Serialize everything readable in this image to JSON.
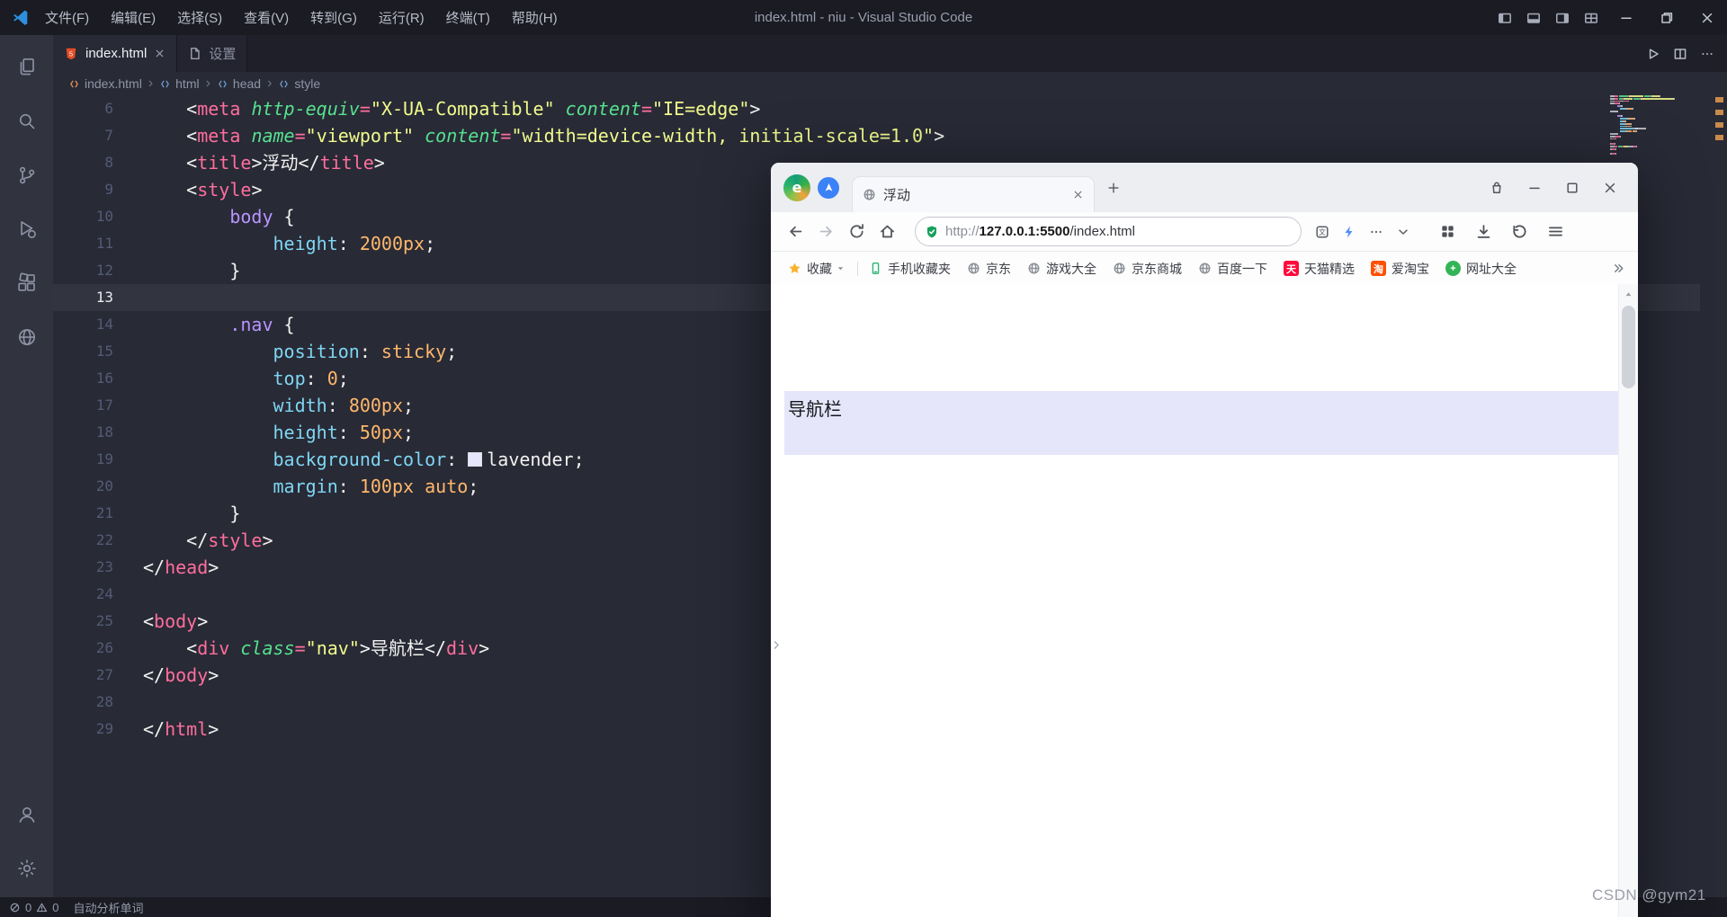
{
  "vscode": {
    "title": "index.html - niu - Visual Studio Code",
    "menu": [
      "文件(F)",
      "编辑(E)",
      "选择(S)",
      "查看(V)",
      "转到(G)",
      "运行(R)",
      "终端(T)",
      "帮助(H)"
    ],
    "tabs": [
      {
        "label": "index.html"
      },
      {
        "label": "设置"
      }
    ],
    "breadcrumb": [
      "index.html",
      "html",
      "head",
      "style"
    ],
    "activity": {
      "top": [
        "explorer",
        "search",
        "source-control",
        "run-debug",
        "extensions",
        "live-preview"
      ],
      "bottom": [
        "account",
        "settings"
      ]
    },
    "status": {
      "errors": "0",
      "warnings": "0",
      "message": "自动分析单词"
    },
    "code": {
      "active_line": 13,
      "lines": [
        {
          "n": 6,
          "t": [
            [
              "pln",
              "    <"
            ],
            [
              "tag",
              "meta"
            ],
            [
              "pln",
              " "
            ],
            [
              "attr",
              "http-equiv"
            ],
            [
              "op",
              "="
            ],
            [
              "str",
              "\"X-UA-Compatible\""
            ],
            [
              "pln",
              " "
            ],
            [
              "attr",
              "content"
            ],
            [
              "op",
              "="
            ],
            [
              "str",
              "\"IE=edge\""
            ],
            [
              "pln",
              ">"
            ]
          ]
        },
        {
          "n": 7,
          "t": [
            [
              "pln",
              "    <"
            ],
            [
              "tag",
              "meta"
            ],
            [
              "pln",
              " "
            ],
            [
              "attr",
              "name"
            ],
            [
              "op",
              "="
            ],
            [
              "str",
              "\"viewport\""
            ],
            [
              "pln",
              " "
            ],
            [
              "attr",
              "content"
            ],
            [
              "op",
              "="
            ],
            [
              "str",
              "\"width=device-width, initial-scale=1.0\""
            ],
            [
              "pln",
              ">"
            ]
          ]
        },
        {
          "n": 8,
          "t": [
            [
              "pln",
              "    <"
            ],
            [
              "tag",
              "title"
            ],
            [
              "pln",
              ">浮动</"
            ],
            [
              "tag",
              "title"
            ],
            [
              "pln",
              ">"
            ]
          ]
        },
        {
          "n": 9,
          "t": [
            [
              "pln",
              "    <"
            ],
            [
              "tag",
              "style"
            ],
            [
              "pln",
              ">"
            ]
          ]
        },
        {
          "n": 10,
          "t": [
            [
              "pln",
              "        "
            ],
            [
              "sel",
              "body"
            ],
            [
              "pln",
              " {"
            ]
          ]
        },
        {
          "n": 11,
          "t": [
            [
              "pln",
              "            "
            ],
            [
              "prop",
              "height"
            ],
            [
              "pln",
              ": "
            ],
            [
              "val",
              "2000px"
            ],
            [
              "pln",
              ";"
            ]
          ]
        },
        {
          "n": 12,
          "t": [
            [
              "pln",
              "        }"
            ]
          ]
        },
        {
          "n": 13,
          "t": []
        },
        {
          "n": 14,
          "t": [
            [
              "pln",
              "        "
            ],
            [
              "sel",
              ".nav"
            ],
            [
              "pln",
              " {"
            ]
          ]
        },
        {
          "n": 15,
          "t": [
            [
              "pln",
              "            "
            ],
            [
              "prop",
              "position"
            ],
            [
              "pln",
              ": "
            ],
            [
              "val",
              "sticky"
            ],
            [
              "pln",
              ";"
            ]
          ]
        },
        {
          "n": 16,
          "t": [
            [
              "pln",
              "            "
            ],
            [
              "prop",
              "top"
            ],
            [
              "pln",
              ": "
            ],
            [
              "val",
              "0"
            ],
            [
              "pln",
              ";"
            ]
          ]
        },
        {
          "n": 17,
          "t": [
            [
              "pln",
              "            "
            ],
            [
              "prop",
              "width"
            ],
            [
              "pln",
              ": "
            ],
            [
              "val",
              "800px"
            ],
            [
              "pln",
              ";"
            ]
          ]
        },
        {
          "n": 18,
          "t": [
            [
              "pln",
              "            "
            ],
            [
              "prop",
              "height"
            ],
            [
              "pln",
              ": "
            ],
            [
              "val",
              "50px"
            ],
            [
              "pln",
              ";"
            ]
          ]
        },
        {
          "n": 19,
          "t": [
            [
              "pln",
              "            "
            ],
            [
              "prop",
              "background-color"
            ],
            [
              "pln",
              ": "
            ],
            [
              "swatch",
              ""
            ],
            [
              "pln",
              "lavender;"
            ]
          ]
        },
        {
          "n": 20,
          "t": [
            [
              "pln",
              "            "
            ],
            [
              "prop",
              "margin"
            ],
            [
              "pln",
              ": "
            ],
            [
              "val",
              "100px"
            ],
            [
              "pln",
              " "
            ],
            [
              "val",
              "auto"
            ],
            [
              "pln",
              ";"
            ]
          ]
        },
        {
          "n": 21,
          "t": [
            [
              "pln",
              "        }"
            ]
          ]
        },
        {
          "n": 22,
          "t": [
            [
              "pln",
              "    </"
            ],
            [
              "tag",
              "style"
            ],
            [
              "pln",
              ">"
            ]
          ]
        },
        {
          "n": 23,
          "t": [
            [
              "pln",
              "</"
            ],
            [
              "tag",
              "head"
            ],
            [
              "pln",
              ">"
            ]
          ]
        },
        {
          "n": 24,
          "t": []
        },
        {
          "n": 25,
          "t": [
            [
              "pln",
              "<"
            ],
            [
              "tag",
              "body"
            ],
            [
              "pln",
              ">"
            ]
          ]
        },
        {
          "n": 26,
          "t": [
            [
              "pln",
              "    <"
            ],
            [
              "tag",
              "div"
            ],
            [
              "pln",
              " "
            ],
            [
              "attr",
              "class"
            ],
            [
              "op",
              "="
            ],
            [
              "str",
              "\"nav\""
            ],
            [
              "pln",
              ">导航栏</"
            ],
            [
              "tag",
              "div"
            ],
            [
              "pln",
              ">"
            ]
          ]
        },
        {
          "n": 27,
          "t": [
            [
              "pln",
              "</"
            ],
            [
              "tag",
              "body"
            ],
            [
              "pln",
              ">"
            ]
          ]
        },
        {
          "n": 28,
          "t": []
        },
        {
          "n": 29,
          "t": [
            [
              "pln",
              "</"
            ],
            [
              "tag",
              "html"
            ],
            [
              "pln",
              ">"
            ]
          ]
        }
      ]
    }
  },
  "browser": {
    "tab_title": "浮动",
    "url": {
      "scheme": "http://",
      "host": "127.0.0.1:5500",
      "path": "/index.html"
    },
    "bookmarks": [
      {
        "label": "收藏",
        "icon": "star",
        "caret": true,
        "sep": true
      },
      {
        "label": "手机收藏夹",
        "icon": "phone"
      },
      {
        "label": "京东",
        "icon": "globe"
      },
      {
        "label": "游戏大全",
        "icon": "globe"
      },
      {
        "label": "京东商城",
        "icon": "globe"
      },
      {
        "label": "百度一下",
        "icon": "globe"
      },
      {
        "label": "天猫精选",
        "icon": "badge",
        "bg": "#ff0a3c",
        "glyph": "天"
      },
      {
        "label": "爱淘宝",
        "icon": "badge",
        "bg": "#ff5000",
        "glyph": "淘"
      },
      {
        "label": "网址大全",
        "icon": "badge-round",
        "bg": "#34b458",
        "glyph": "+"
      }
    ],
    "page": {
      "nav_text": "导航栏"
    }
  },
  "watermark": "CSDN @gym21",
  "colors": {
    "lavender": "#E6E6FA",
    "html_icon": "#e44d26",
    "star": "#f7b32b",
    "shield_green": "#16a05d"
  }
}
